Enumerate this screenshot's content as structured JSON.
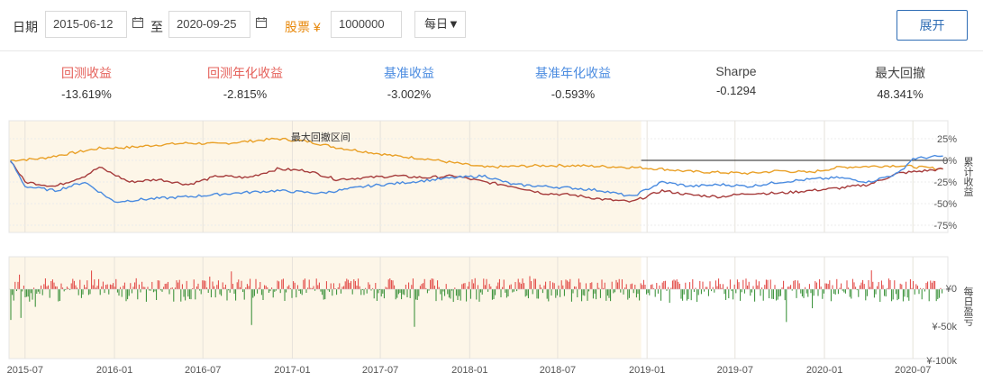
{
  "toolbar": {
    "date_label": "日期",
    "start_date": "2015-06-12",
    "to_label": "至",
    "end_date": "2020-09-25",
    "stock_label": "股票 ¥",
    "capital": "1000000",
    "frequency": "每日▼",
    "expand_label": "展开"
  },
  "stats": [
    {
      "title": "回测收益",
      "value": "-13.619%",
      "color": "#e5605a"
    },
    {
      "title": "回测年化收益",
      "value": "-2.815%",
      "color": "#e5605a"
    },
    {
      "title": "基准收益",
      "value": "-3.002%",
      "color": "#4a8be0"
    },
    {
      "title": "基准年化收益",
      "value": "-0.593%",
      "color": "#4a8be0"
    },
    {
      "title": "Sharpe",
      "value": "-0.1294",
      "color": "#444444"
    },
    {
      "title": "最大回撤",
      "value": "48.341%",
      "color": "#444444"
    }
  ],
  "colors": {
    "backtest": "#a63c3c",
    "benchmark": "#4a8be0",
    "excess": "#e9a027",
    "drawdown_fill": "#fdf6e8",
    "profit_bar": "#e0403c",
    "loss_bar": "#2e8b2e"
  },
  "chart_data": [
    {
      "type": "line",
      "annotation": "最大回撤区间",
      "ylabel": "累计收益",
      "yticks": [
        "25%",
        "0%",
        "-25%",
        "-50%",
        "-75%"
      ],
      "ylim": [
        -75,
        25
      ],
      "drawdown_period": [
        "2015-06-12",
        "2019-01-03"
      ],
      "series": [
        {
          "name": "",
          "color": "#e9a027",
          "x": [
            "2015-06",
            "2015-08",
            "2015-10",
            "2015-12",
            "2016-02",
            "2016-04",
            "2016-06",
            "2016-08",
            "2016-10",
            "2016-12",
            "2017-02",
            "2017-04",
            "2017-06",
            "2017-08",
            "2017-10",
            "2017-12",
            "2018-02",
            "2018-04",
            "2018-06",
            "2018-08",
            "2018-10",
            "2018-12",
            "2019-02",
            "2019-04",
            "2019-06",
            "2019-08",
            "2019-10",
            "2019-12",
            "2020-02",
            "2020-04",
            "2020-06",
            "2020-09"
          ],
          "values": [
            0,
            2,
            8,
            14,
            15,
            18,
            20,
            19,
            22,
            25,
            22,
            15,
            10,
            5,
            2,
            -3,
            -8,
            -7,
            -6,
            -6,
            -7,
            -8,
            -10,
            -13,
            -14,
            -15,
            -12,
            -14,
            -8,
            -7,
            -6,
            -10
          ]
        },
        {
          "name": "",
          "color": "#a63c3c",
          "x": [
            "2015-06",
            "2015-07",
            "2015-09",
            "2015-11",
            "2015-12",
            "2016-02",
            "2016-04",
            "2016-06",
            "2016-08",
            "2016-10",
            "2016-12",
            "2017-02",
            "2017-04",
            "2017-06",
            "2017-08",
            "2017-10",
            "2017-12",
            "2018-02",
            "2018-04",
            "2018-06",
            "2018-08",
            "2018-10",
            "2018-12",
            "2019-02",
            "2019-04",
            "2019-06",
            "2019-08",
            "2019-10",
            "2019-12",
            "2020-02",
            "2020-04",
            "2020-06",
            "2020-09"
          ],
          "values": [
            0,
            -25,
            -30,
            -18,
            -8,
            -25,
            -22,
            -28,
            -18,
            -20,
            -10,
            -12,
            -22,
            -20,
            -18,
            -20,
            -18,
            -25,
            -30,
            -38,
            -40,
            -45,
            -48,
            -35,
            -40,
            -42,
            -38,
            -38,
            -35,
            -32,
            -28,
            -15,
            -10
          ]
        },
        {
          "name": "",
          "color": "#4a8be0",
          "x": [
            "2015-06",
            "2015-07",
            "2015-09",
            "2015-11",
            "2016-01",
            "2016-03",
            "2016-06",
            "2016-09",
            "2016-12",
            "2017-03",
            "2017-06",
            "2017-09",
            "2017-12",
            "2018-02",
            "2018-04",
            "2018-06",
            "2018-08",
            "2018-10",
            "2018-12",
            "2019-02",
            "2019-04",
            "2019-06",
            "2019-08",
            "2019-10",
            "2019-12",
            "2020-02",
            "2020-04",
            "2020-06",
            "2020-07",
            "2020-09"
          ],
          "values": [
            0,
            -30,
            -35,
            -25,
            -48,
            -45,
            -42,
            -38,
            -35,
            -38,
            -30,
            -25,
            -20,
            -18,
            -28,
            -30,
            -32,
            -35,
            -42,
            -25,
            -30,
            -28,
            -30,
            -25,
            -22,
            -20,
            -25,
            -15,
            2,
            5
          ]
        }
      ]
    },
    {
      "type": "bar",
      "ylabel": "每日盈亏",
      "yticks": [
        "¥0",
        "¥-50k",
        "¥-100k"
      ],
      "ylim": [
        -100000,
        30000
      ]
    }
  ],
  "xaxis": {
    "ticks": [
      "2015-07",
      "2016-01",
      "2016-07",
      "2017-01",
      "2017-07",
      "2018-01",
      "2018-07",
      "2019-01",
      "2019-07",
      "2020-01",
      "2020-07"
    ]
  }
}
